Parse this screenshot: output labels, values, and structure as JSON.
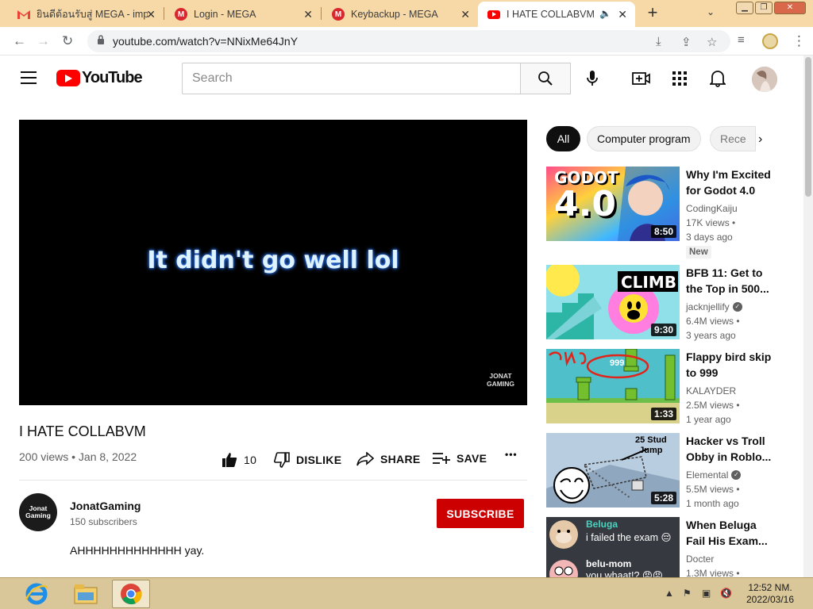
{
  "browser": {
    "tabs": [
      {
        "title": "ยินดีต้อนรับสู่ MEGA - impr",
        "icon": "gmail-icon"
      },
      {
        "title": "Login - MEGA",
        "icon": "mega-icon"
      },
      {
        "title": "Keybackup - MEGA",
        "icon": "mega-icon"
      },
      {
        "title": "I HATE COLLABVM -",
        "icon": "youtube-icon",
        "active": true
      }
    ],
    "url": "youtube.com/watch?v=NNixMe64JnY"
  },
  "youtube": {
    "logo_text": "YouTube",
    "search_placeholder": "Search",
    "video": {
      "caption": "It didn't go well lol",
      "watermark_line1": "JONAT",
      "watermark_line2": "GAMING",
      "title": "I HATE COLLABVM",
      "meta": "200 views • Jan 8, 2022",
      "likes": "10",
      "dislike_label": "DISLIKE",
      "share_label": "SHARE",
      "save_label": "SAVE",
      "more_label": "•••"
    },
    "channel": {
      "avatar_line1": "Jonat",
      "avatar_line2": "Gaming",
      "name": "JonatGaming",
      "subscribers": "150 subscribers",
      "subscribe_label": "SUBSCRIBE",
      "description": "AHHHHHHHHHHHHH yay."
    },
    "chips": [
      "All",
      "Computer program",
      "Rece"
    ],
    "recommendations": [
      {
        "title": "Why I'm Excited for Godot 4.0",
        "channel": "CodingKaiju",
        "views": "17K views •",
        "age": "3 days ago",
        "duration": "8:50",
        "badge": "New",
        "verified": false,
        "thumb_text": "GODOT 4.0"
      },
      {
        "title": "BFB 11: Get to the Top in 500...",
        "channel": "jacknjellify",
        "views": "6.4M views •",
        "age": "3 years ago",
        "duration": "9:30",
        "verified": true,
        "thumb_text": "CLIMB"
      },
      {
        "title": "Flappy bird skip to 999",
        "channel": "KALAYDER",
        "views": "2.5M views •",
        "age": "1 year ago",
        "duration": "1:33",
        "verified": false,
        "thumb_text": "OMG 999"
      },
      {
        "title": "Hacker vs Troll Obby in Roblo...",
        "channel": "Elemental",
        "views": "5.5M views •",
        "age": "1 month ago",
        "duration": "5:28",
        "verified": true,
        "thumb_text": "25 Stud Jump"
      },
      {
        "title": "When Beluga Fail His Exam...",
        "channel": "Docter",
        "views": "1.3M views •",
        "age": "",
        "duration": "",
        "verified": false,
        "thumb_text": "Beluga i failed the exam belu-mom you whaat!?"
      }
    ]
  },
  "taskbar": {
    "time": "12:52 NM.",
    "date": "2022/03/16"
  }
}
